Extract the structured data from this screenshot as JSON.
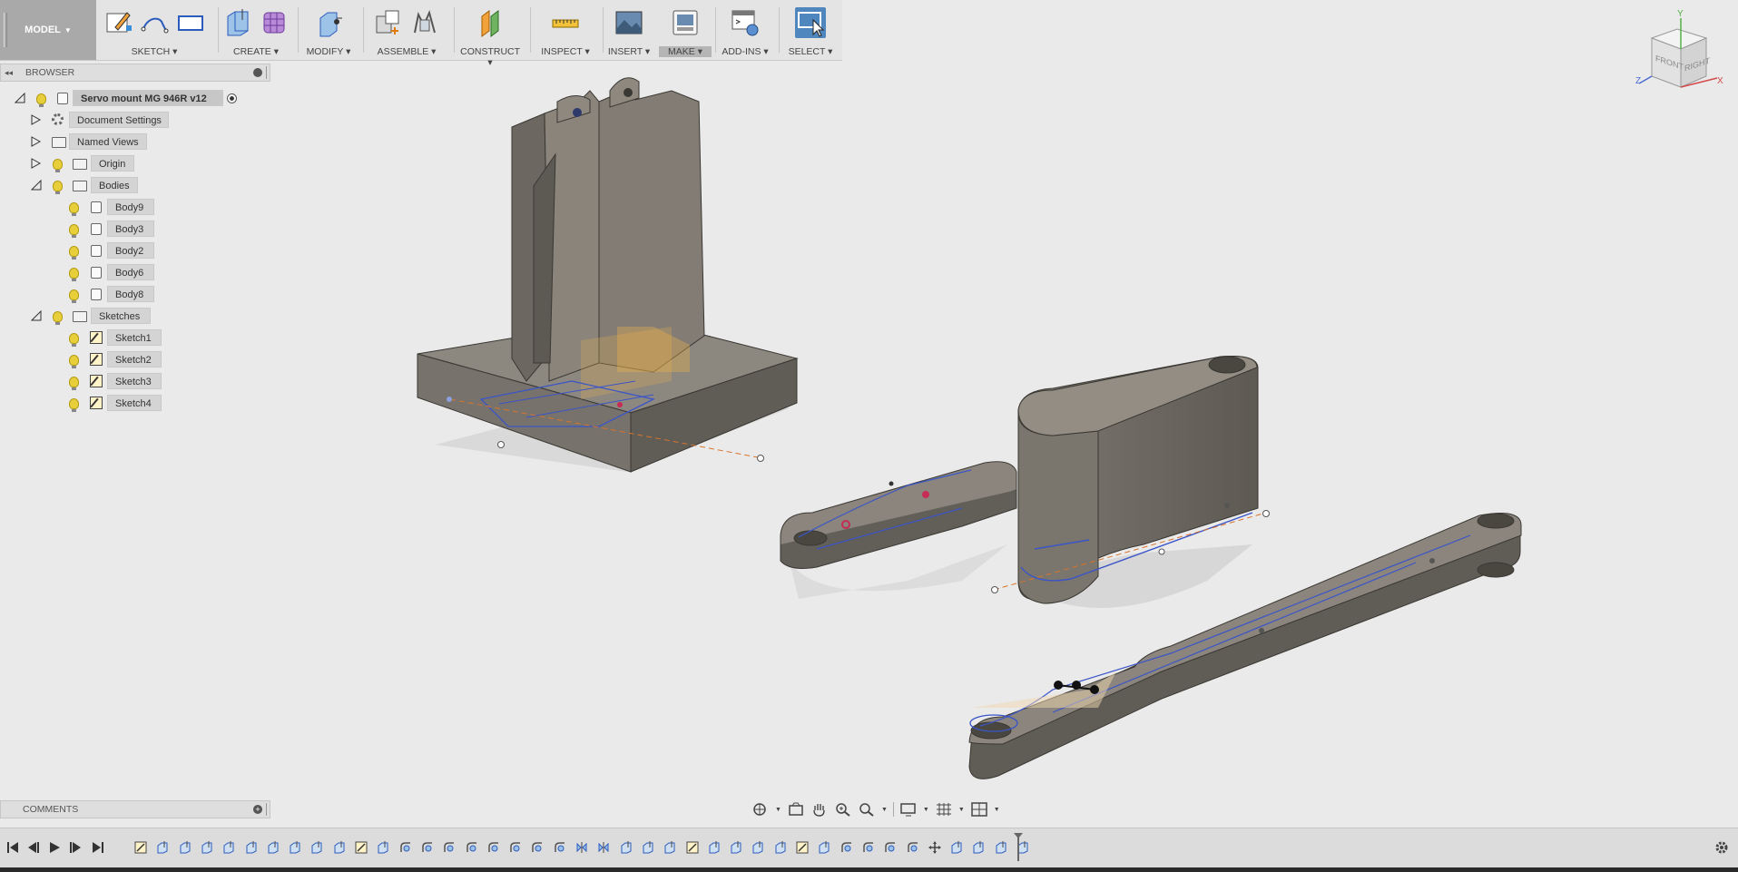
{
  "toolbar": {
    "workspace": "MODEL",
    "groups": [
      {
        "label": "SKETCH"
      },
      {
        "label": "CREATE"
      },
      {
        "label": "MODIFY"
      },
      {
        "label": "ASSEMBLE"
      },
      {
        "label": "CONSTRUCT"
      },
      {
        "label": "INSPECT"
      },
      {
        "label": "INSERT"
      },
      {
        "label": "MAKE"
      },
      {
        "label": "ADD-INS"
      },
      {
        "label": "SELECT"
      }
    ]
  },
  "browser": {
    "title": "BROWSER",
    "root": "Servo mount MG 946R v12",
    "items": {
      "document_settings": "Document Settings",
      "named_views": "Named Views",
      "origin": "Origin",
      "bodies": "Bodies",
      "sketches": "Sketches"
    },
    "bodies": [
      "Body9",
      "Body3",
      "Body2",
      "Body6",
      "Body8"
    ],
    "sketches": [
      "Sketch1",
      "Sketch2",
      "Sketch3",
      "Sketch4"
    ]
  },
  "comments": {
    "title": "COMMENTS"
  },
  "viewcube": {
    "front": "FRONT",
    "right": "RIGHT",
    "axis_x": "X",
    "axis_y": "Y",
    "axis_z": "Z"
  },
  "colors": {
    "body": "#7a756d",
    "sketch_line": "#3a55c8",
    "accent_select": "#4f86bd",
    "highlight": "#f0b44a"
  },
  "icons": {
    "toolbar": [
      "create-sketch-icon",
      "line-icon",
      "rectangle-icon",
      "extrude-icon",
      "form-icon",
      "press-pull-icon",
      "new-component-icon",
      "joint-icon",
      "offset-plane-icon",
      "measure-icon",
      "insert-image-icon",
      "make-3dprint-icon",
      "scripts-icon",
      "select-icon"
    ]
  }
}
